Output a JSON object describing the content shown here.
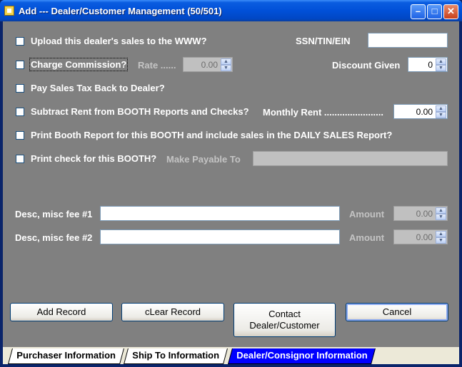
{
  "window": {
    "title": "Add --- Dealer/Customer Management (50/501)",
    "min_label": "–",
    "max_label": "□",
    "close_label": "✕"
  },
  "form": {
    "upload_www": {
      "label": "Upload this dealer's sales to the WWW?",
      "checked": false
    },
    "ssn_label": "SSN/TIN/EIN",
    "ssn_value": "",
    "charge_commission": {
      "label": "Charge Commission?",
      "checked": false
    },
    "rate_label": "Rate ......",
    "rate_value": "0.00",
    "discount_label": "Discount Given",
    "discount_value": "0",
    "pay_sales_tax": {
      "label": "Pay Sales Tax Back to Dealer?",
      "checked": false
    },
    "subtract_rent": {
      "label": "Subtract Rent from BOOTH Reports and Checks?",
      "checked": false
    },
    "monthly_rent_label": "Monthly Rent .......................",
    "monthly_rent_value": "0.00",
    "print_booth": {
      "label": "Print Booth Report for this BOOTH and include sales in the DAILY SALES Report?",
      "checked": false
    },
    "print_check": {
      "label": "Print check for this BOOTH?",
      "checked": false
    },
    "payable_label": "Make Payable To",
    "payable_value": "",
    "misc1_label": "Desc, misc fee #1",
    "misc1_value": "",
    "amount1_label": "Amount",
    "amount1_value": "0.00",
    "misc2_label": "Desc, misc fee #2",
    "misc2_value": "",
    "amount2_label": "Amount",
    "amount2_value": "0.00"
  },
  "buttons": {
    "add_record": "Add Record",
    "clear_record": "cLear Record",
    "contact_line1": "Contact",
    "contact_line2": "Dealer/Customer",
    "cancel": "Cancel"
  },
  "tabs": [
    {
      "label": "Purchaser Information",
      "active": false
    },
    {
      "label": "Ship To Information",
      "active": false
    },
    {
      "label": "Dealer/Consignor Information",
      "active": true
    }
  ],
  "colors": {
    "background": "#808080",
    "title_bar": "#0150d8",
    "active_tab": "#0000ff"
  }
}
